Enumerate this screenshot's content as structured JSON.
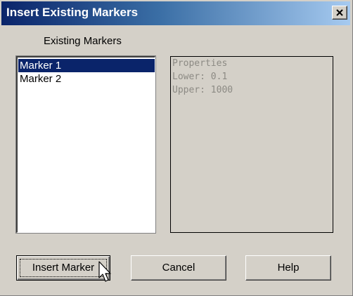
{
  "window": {
    "title": "Insert Existing Markers",
    "close_icon": "close-x-icon"
  },
  "markers": {
    "label": "Existing Markers",
    "items": [
      {
        "label": "Marker 1",
        "selected": true
      },
      {
        "label": "Marker 2",
        "selected": false
      }
    ]
  },
  "properties": {
    "heading": "Properties",
    "lower": "Lower: 0.1",
    "upper": "Upper: 1000"
  },
  "buttons": {
    "insert": "Insert Marker",
    "cancel": "Cancel",
    "help": "Help"
  },
  "colors": {
    "selection": "#0a246a",
    "face": "#d4d0c8",
    "disabled_text": "#8c8a84"
  }
}
